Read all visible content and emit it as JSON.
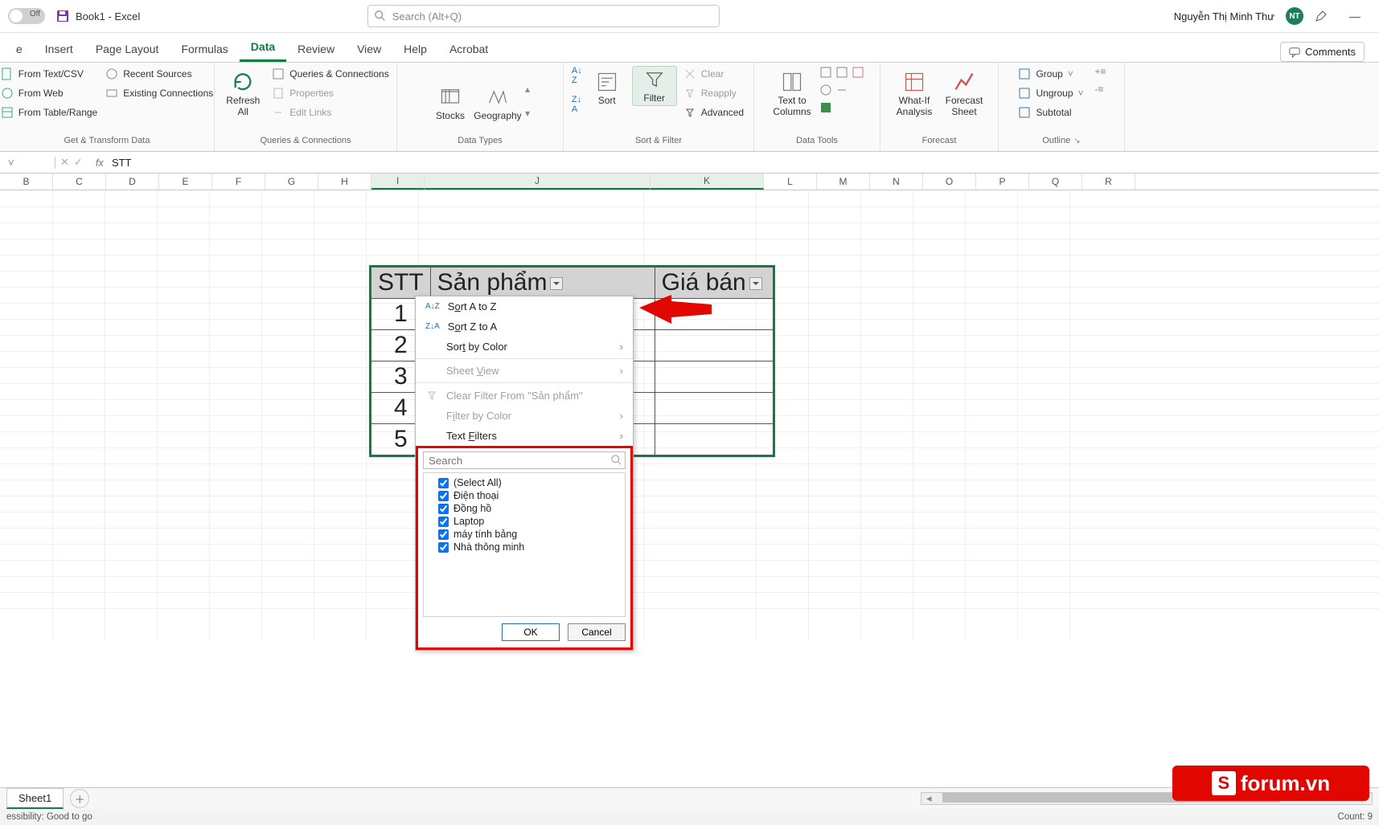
{
  "title": {
    "autosave_off": "Off",
    "doc": "Book1  -  Excel",
    "search_placeholder": "Search (Alt+Q)",
    "user": "Nguyễn Thị Minh Thư",
    "user_initials": "NT"
  },
  "tabs": {
    "items": [
      "e",
      "Insert",
      "Page Layout",
      "Formulas",
      "Data",
      "Review",
      "View",
      "Help",
      "Acrobat"
    ],
    "active": "Data",
    "comments": "Comments"
  },
  "ribbon": {
    "get": {
      "items": [
        "From Text/CSV",
        "From Web",
        "From Table/Range",
        "Recent Sources",
        "Existing Connections"
      ],
      "label": "Get & Transform Data"
    },
    "refresh": {
      "big": "Refresh\nAll",
      "items": [
        "Queries & Connections",
        "Properties",
        "Edit Links"
      ],
      "label": "Queries & Connections"
    },
    "types": {
      "stocks": "Stocks",
      "geo": "Geography",
      "label": "Data Types"
    },
    "sort": {
      "sort": "Sort",
      "filter": "Filter",
      "clear": "Clear",
      "reapply": "Reapply",
      "advanced": "Advanced",
      "label": "Sort & Filter"
    },
    "tools": {
      "t2c": "Text to\nColumns",
      "label": "Data Tools"
    },
    "forecast": {
      "whatif": "What-If\nAnalysis",
      "sheet": "Forecast\nSheet",
      "label": "Forecast"
    },
    "outline": {
      "group": "Group",
      "ungroup": "Ungroup",
      "subtotal": "Subtotal",
      "label": "Outline"
    }
  },
  "formula": {
    "cell": "",
    "fx": "fx",
    "value": "STT"
  },
  "columns": [
    "B",
    "C",
    "D",
    "E",
    "F",
    "G",
    "H",
    "I",
    "J",
    "K",
    "L",
    "M",
    "N",
    "O",
    "P",
    "Q",
    "R"
  ],
  "table": {
    "headers": [
      "STT",
      "Sản phẩm",
      "Giá bán"
    ],
    "rows": [
      [
        "1",
        "",
        ""
      ],
      [
        "2",
        "",
        ""
      ],
      [
        "3",
        "",
        ""
      ],
      [
        "4",
        "",
        ""
      ],
      [
        "5",
        "",
        ""
      ]
    ]
  },
  "dropdown": {
    "sort_az": "Sort A to Z",
    "sort_za": "Sort Z to A",
    "sort_color": "Sort by Color",
    "sheet_view": "Sheet View",
    "clear": "Clear Filter From \"Sản phẩm\"",
    "filter_color": "Filter by Color",
    "text_filters": "Text Filters",
    "search_ph": "Search",
    "options": [
      "(Select All)",
      "Điện thoại",
      "Đồng hồ",
      "Laptop",
      "máy tính bảng",
      "Nhà thông minh"
    ],
    "ok": "OK",
    "cancel": "Cancel"
  },
  "sheet": {
    "name": "Sheet1"
  },
  "status": {
    "left": "essibility: Good to go",
    "right": "Count: 9"
  },
  "watermark": "forum.vn"
}
